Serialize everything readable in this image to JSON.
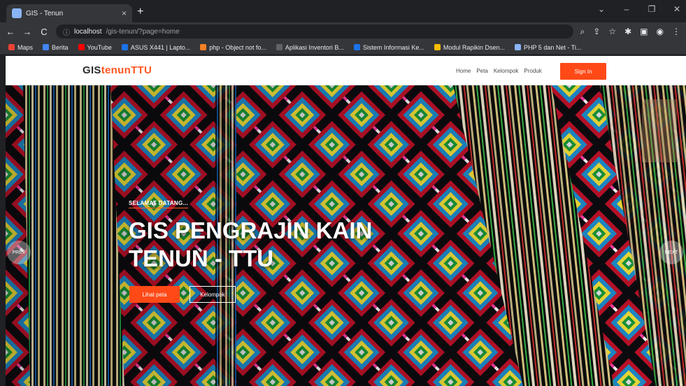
{
  "browser": {
    "tab_title": "GIS - Tenun",
    "tab_close": "×",
    "new_tab": "+",
    "window_controls": [
      "⌄",
      "–",
      "❐",
      "✕"
    ],
    "address_host": "localhost",
    "address_path": "/gis-tenun/?page=home",
    "nav_icons": [
      "←",
      "→",
      "C",
      "ⓘ"
    ],
    "toolbar_icons": [
      "⌕",
      "⇪",
      "☆",
      "✱",
      "▣",
      "◉",
      "⋮"
    ],
    "bookmarks": [
      {
        "label": "Maps",
        "color": "#ea4335"
      },
      {
        "label": "Berita",
        "color": "#4285f4"
      },
      {
        "label": "YouTube",
        "color": "#ff0000"
      },
      {
        "label": "ASUS X441 | Lapto...",
        "color": "#1a73e8"
      },
      {
        "label": "php - Object not fo...",
        "color": "#f48024"
      },
      {
        "label": "Aplikasi Inventori B...",
        "color": "#5f6368"
      },
      {
        "label": "Sistem Informasi Ke...",
        "color": "#1a73e8"
      },
      {
        "label": "Modul Rapikin Dsen...",
        "color": "#fbbc04"
      },
      {
        "label": "PHP 5 dan Net - Ti...",
        "color": "#8ab4f8"
      }
    ]
  },
  "site": {
    "logo_part1": "GIS",
    "logo_part2": "tenunTTU",
    "nav": [
      "Home",
      "Peta",
      "Kelompok",
      "Produk"
    ],
    "signin_label": "Sign In",
    "accent_color": "#ff4a17"
  },
  "hero": {
    "welcome": "SELAMAT DATANG...",
    "title": "GIS PENGRAJIN KAIN TENUN - TTU",
    "button_primary": "Lihat peta",
    "button_secondary": "Kelompok",
    "prev_label": "PREV",
    "next_label": "NEXT"
  }
}
